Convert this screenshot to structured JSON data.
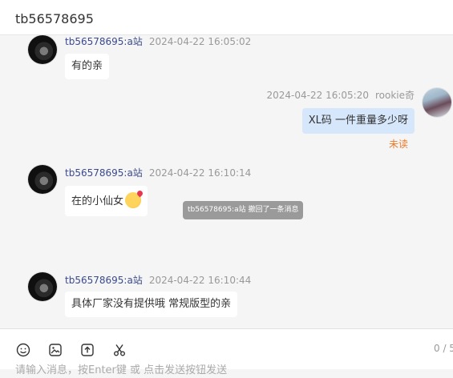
{
  "header": {
    "title": "tb56578695"
  },
  "messages": [
    {
      "sender": "tb56578695:a站",
      "time": "2024-04-22 16:05:02",
      "text": "有的亲"
    },
    {
      "sender": "rookie奇",
      "time": "2024-04-22 16:05:20",
      "text": "XL码  一件重量多少呀",
      "status": "未读"
    },
    {
      "sender": "tb56578695:a站",
      "time": "2024-04-22 16:10:14",
      "text": "在的小仙女"
    },
    {
      "sender": "tb56578695:a站",
      "time": "2024-04-22 16:10:44",
      "text": "具体厂家没有提供哦 常规版型的亲"
    }
  ],
  "recall_notice": "tb56578695:a站 撤回了一条消息",
  "footer": {
    "counter": "0 / 5",
    "input_placeholder": "请输入消息，按Enter键 或 点击发送按钮发送",
    "icons": [
      "emoji-icon",
      "image-icon",
      "upload-icon",
      "scissors-icon"
    ]
  }
}
